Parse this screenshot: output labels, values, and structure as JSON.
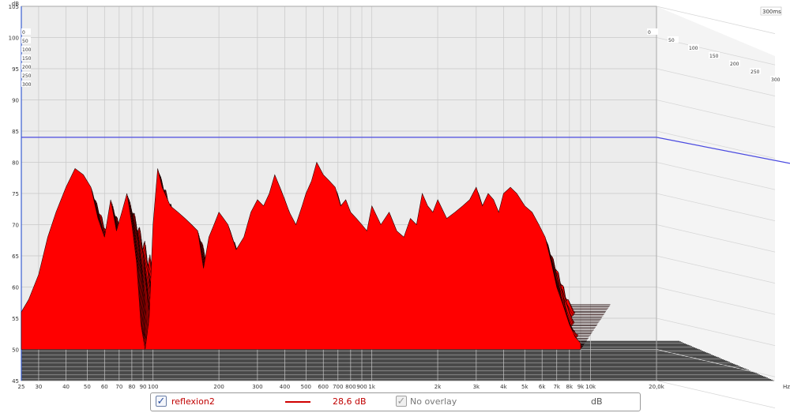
{
  "chart_data": {
    "type": "area",
    "variant": "waterfall-3d",
    "colors": {
      "fill": "#ff0000",
      "edge": "#1a0000",
      "reference": "#4a4ae0",
      "wall": "#ececec",
      "grid": "#c8c8c8"
    },
    "y_axis": {
      "unit": "dB",
      "range": [
        45,
        105
      ],
      "ticks": [
        "45",
        "50",
        "55",
        "60",
        "65",
        "70",
        "75",
        "80",
        "85",
        "90",
        "95",
        "100",
        "105"
      ]
    },
    "x_axis": {
      "unit": "Hz",
      "scale": "log",
      "range": [
        25,
        20000
      ],
      "ticks": [
        {
          "v": 25,
          "t": "25"
        },
        {
          "v": 30,
          "t": "30"
        },
        {
          "v": 40,
          "t": "40"
        },
        {
          "v": 50,
          "t": "50"
        },
        {
          "v": 60,
          "t": "60"
        },
        {
          "v": 70,
          "t": "70"
        },
        {
          "v": 80,
          "t": "80"
        },
        {
          "v": 90,
          "t": "90"
        },
        {
          "v": 100,
          "t": "100"
        },
        {
          "v": 200,
          "t": "200"
        },
        {
          "v": 300,
          "t": "300"
        },
        {
          "v": 400,
          "t": "400"
        },
        {
          "v": 500,
          "t": "500"
        },
        {
          "v": 600,
          "t": "600"
        },
        {
          "v": 700,
          "t": "700"
        },
        {
          "v": 800,
          "t": "800"
        },
        {
          "v": 900,
          "t": "900"
        },
        {
          "v": 1000,
          "t": "1k"
        },
        {
          "v": 2000,
          "t": "2k"
        },
        {
          "v": 3000,
          "t": "3k"
        },
        {
          "v": 4000,
          "t": "4k"
        },
        {
          "v": 5000,
          "t": "5k"
        },
        {
          "v": 6000,
          "t": "6k"
        },
        {
          "v": 7000,
          "t": "7k"
        },
        {
          "v": 8000,
          "t": "8k"
        },
        {
          "v": 9000,
          "t": "9k"
        },
        {
          "v": 10000,
          "t": "10k"
        },
        {
          "v": 20000,
          "t": "20,0k"
        }
      ]
    },
    "time_axis": {
      "unit": "ms",
      "ticks": [
        "0",
        "50",
        "100",
        "150",
        "200",
        "250",
        "300"
      ],
      "corner_label": "300ms"
    },
    "reference_level_db": 84,
    "front_slice": {
      "time_ms": 0,
      "x": [
        25,
        27,
        30,
        33,
        36,
        40,
        44,
        48,
        52,
        56,
        60,
        64,
        68,
        72,
        76,
        80,
        84,
        88,
        92,
        96,
        100,
        105,
        110,
        120,
        130,
        140,
        150,
        160,
        170,
        180,
        190,
        200,
        210,
        220,
        240,
        260,
        280,
        300,
        320,
        340,
        360,
        380,
        400,
        420,
        450,
        480,
        500,
        530,
        560,
        600,
        640,
        680,
        720,
        760,
        800,
        850,
        900,
        950,
        1000,
        1100,
        1200,
        1300,
        1400,
        1500,
        1600,
        1700,
        1800,
        1900,
        2000,
        2200,
        2400,
        2600,
        2800,
        3000,
        3200,
        3400,
        3600,
        3800,
        4000,
        4300,
        4600,
        5000,
        5400,
        5800,
        6200,
        6600,
        7000,
        7500,
        8000,
        8500,
        9000
      ],
      "y": [
        56,
        58,
        62,
        68,
        72,
        76,
        79,
        78,
        76,
        71,
        68,
        74,
        69,
        72,
        75,
        70,
        64,
        54,
        50,
        55,
        70,
        79,
        76,
        73,
        72,
        71,
        70,
        69,
        63,
        68,
        70,
        72,
        71,
        70,
        66,
        68,
        72,
        74,
        73,
        75,
        78,
        76,
        74,
        72,
        70,
        73,
        75,
        77,
        80,
        78,
        77,
        76,
        73,
        74,
        72,
        71,
        70,
        69,
        73,
        70,
        72,
        69,
        68,
        71,
        70,
        75,
        73,
        72,
        74,
        71,
        72,
        73,
        74,
        76,
        73,
        75,
        74,
        72,
        75,
        76,
        75,
        73,
        72,
        70,
        68,
        64,
        60,
        57,
        54,
        52,
        51
      ],
      "y_unit": "dB"
    }
  },
  "legend": {
    "measurement": "reflexion2",
    "range_value": "28,6 dB",
    "overlay": "No overlay",
    "unit": "dB"
  }
}
